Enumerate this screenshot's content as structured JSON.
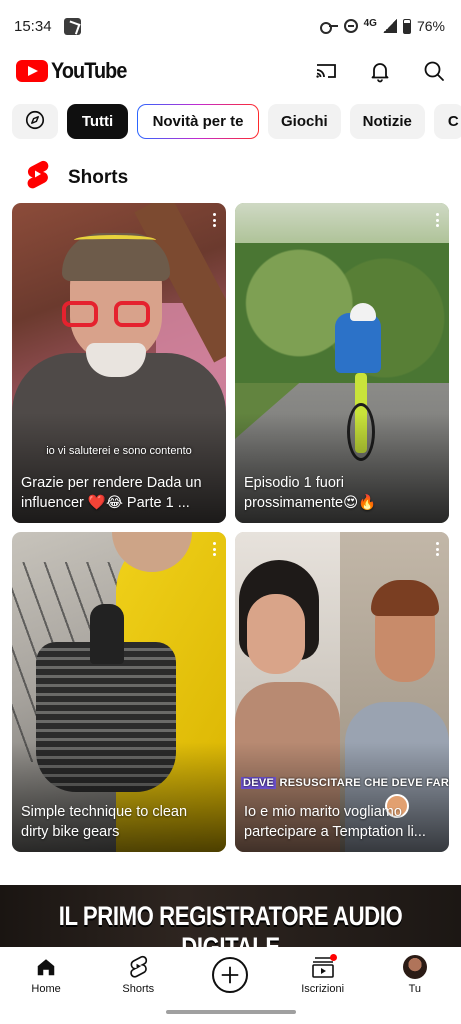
{
  "status_bar": {
    "time": "15:34",
    "network": "4G",
    "battery": "76%"
  },
  "header": {
    "logo_text": "YouTube",
    "icons": [
      "cast-icon",
      "bell-icon",
      "search-icon"
    ]
  },
  "chips": {
    "explore_icon": "compass-icon",
    "items": [
      "Tutti",
      "Novità per te",
      "Giochi",
      "Notizie",
      "C"
    ]
  },
  "shorts": {
    "title": "Shorts",
    "cards": [
      {
        "title": "Grazie per rendere Dada un influencer ❤️😂 Parte 1 ...",
        "caption": "io vi saluterei e sono contento"
      },
      {
        "title": "Episodio 1 fuori prossimamente😍🔥"
      },
      {
        "title": "Simple technique to clean dirty bike gears"
      },
      {
        "title": "Io e mio marito vogliamo partecipare a Temptation li...",
        "overlay_tag": "DEVE",
        "overlay_rest": " RESUSCITARE CHE DEVE FARE"
      }
    ]
  },
  "banner": {
    "text": "IL PRIMO REGISTRATORE AUDIO DIGITALE"
  },
  "bottom_nav": {
    "items": [
      "Home",
      "Shorts",
      "",
      "Iscrizioni",
      "Tu"
    ]
  },
  "colors": {
    "brand_red": "#ff0000",
    "chip_active": "#0f0f0f",
    "chip_bg": "#f2f2f2"
  }
}
